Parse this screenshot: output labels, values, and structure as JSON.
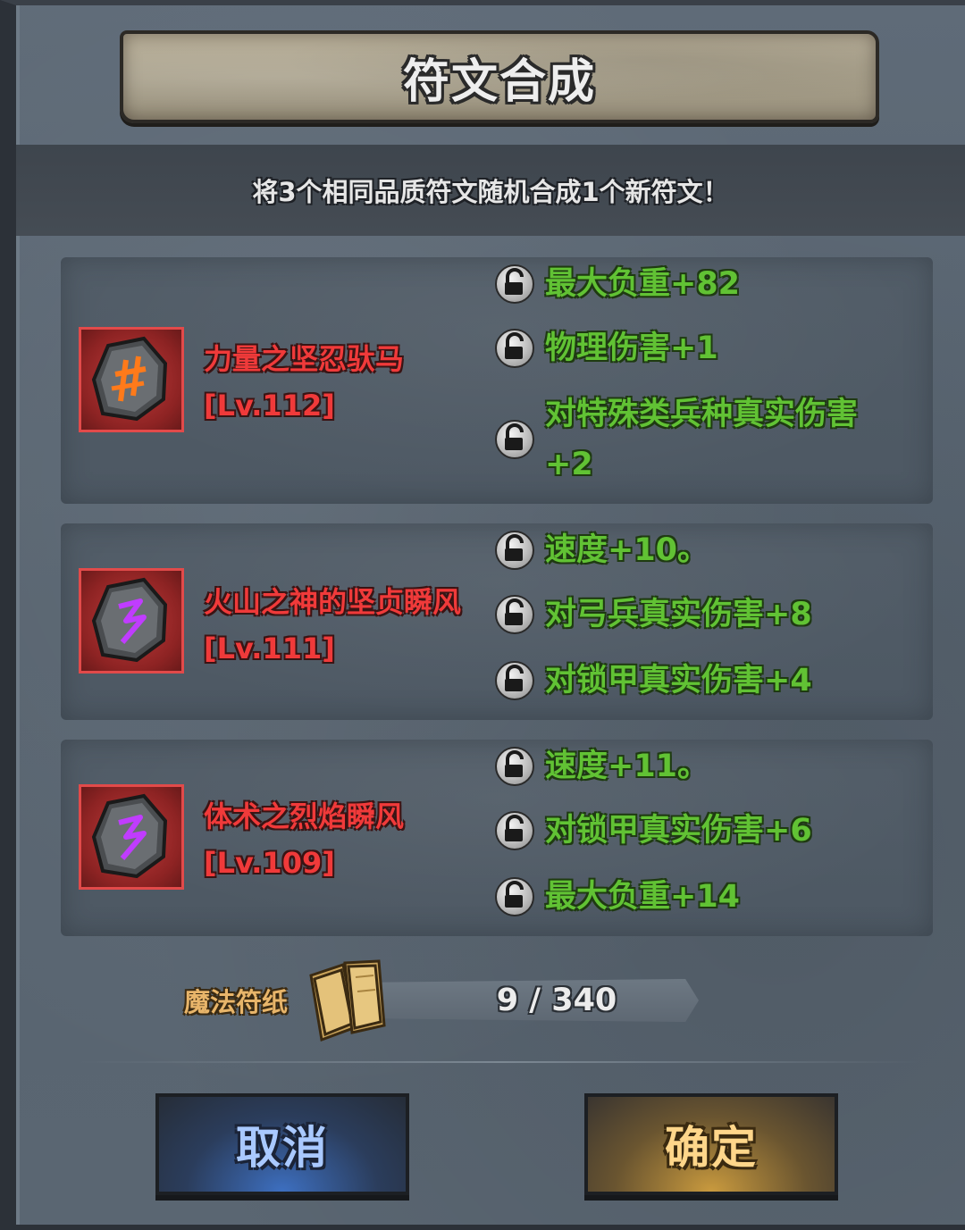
{
  "title": "符文合成",
  "description": "将3个相同品质符文随机合成1个新符文！",
  "runes": [
    {
      "name": "力量之坚忍驮马",
      "level": "[Lv.112]",
      "glyph_color": "#ff7a1a",
      "attributes": [
        "最大负重+82",
        "物理伤害+1",
        "对特殊类兵种真实伤害+2"
      ]
    },
    {
      "name": "火山之神的坚贞瞬风",
      "level": "[Lv.111]",
      "glyph_color": "#c03cff",
      "attributes": [
        "速度+10。",
        "对弓兵真实伤害+8",
        "对锁甲真实伤害+4"
      ]
    },
    {
      "name": "体术之烈焰瞬风",
      "level": "[Lv.109]",
      "glyph_color": "#c03cff",
      "attributes": [
        "速度+11。",
        "对锁甲真实伤害+6",
        "最大负重+14"
      ]
    }
  ],
  "paper": {
    "label": "魔法符纸",
    "count": "9 / 340"
  },
  "buttons": {
    "cancel": "取消",
    "confirm": "确定"
  },
  "icons": {
    "lock": "unlocked-padlock-icon",
    "paper": "magic-paper-icon"
  }
}
